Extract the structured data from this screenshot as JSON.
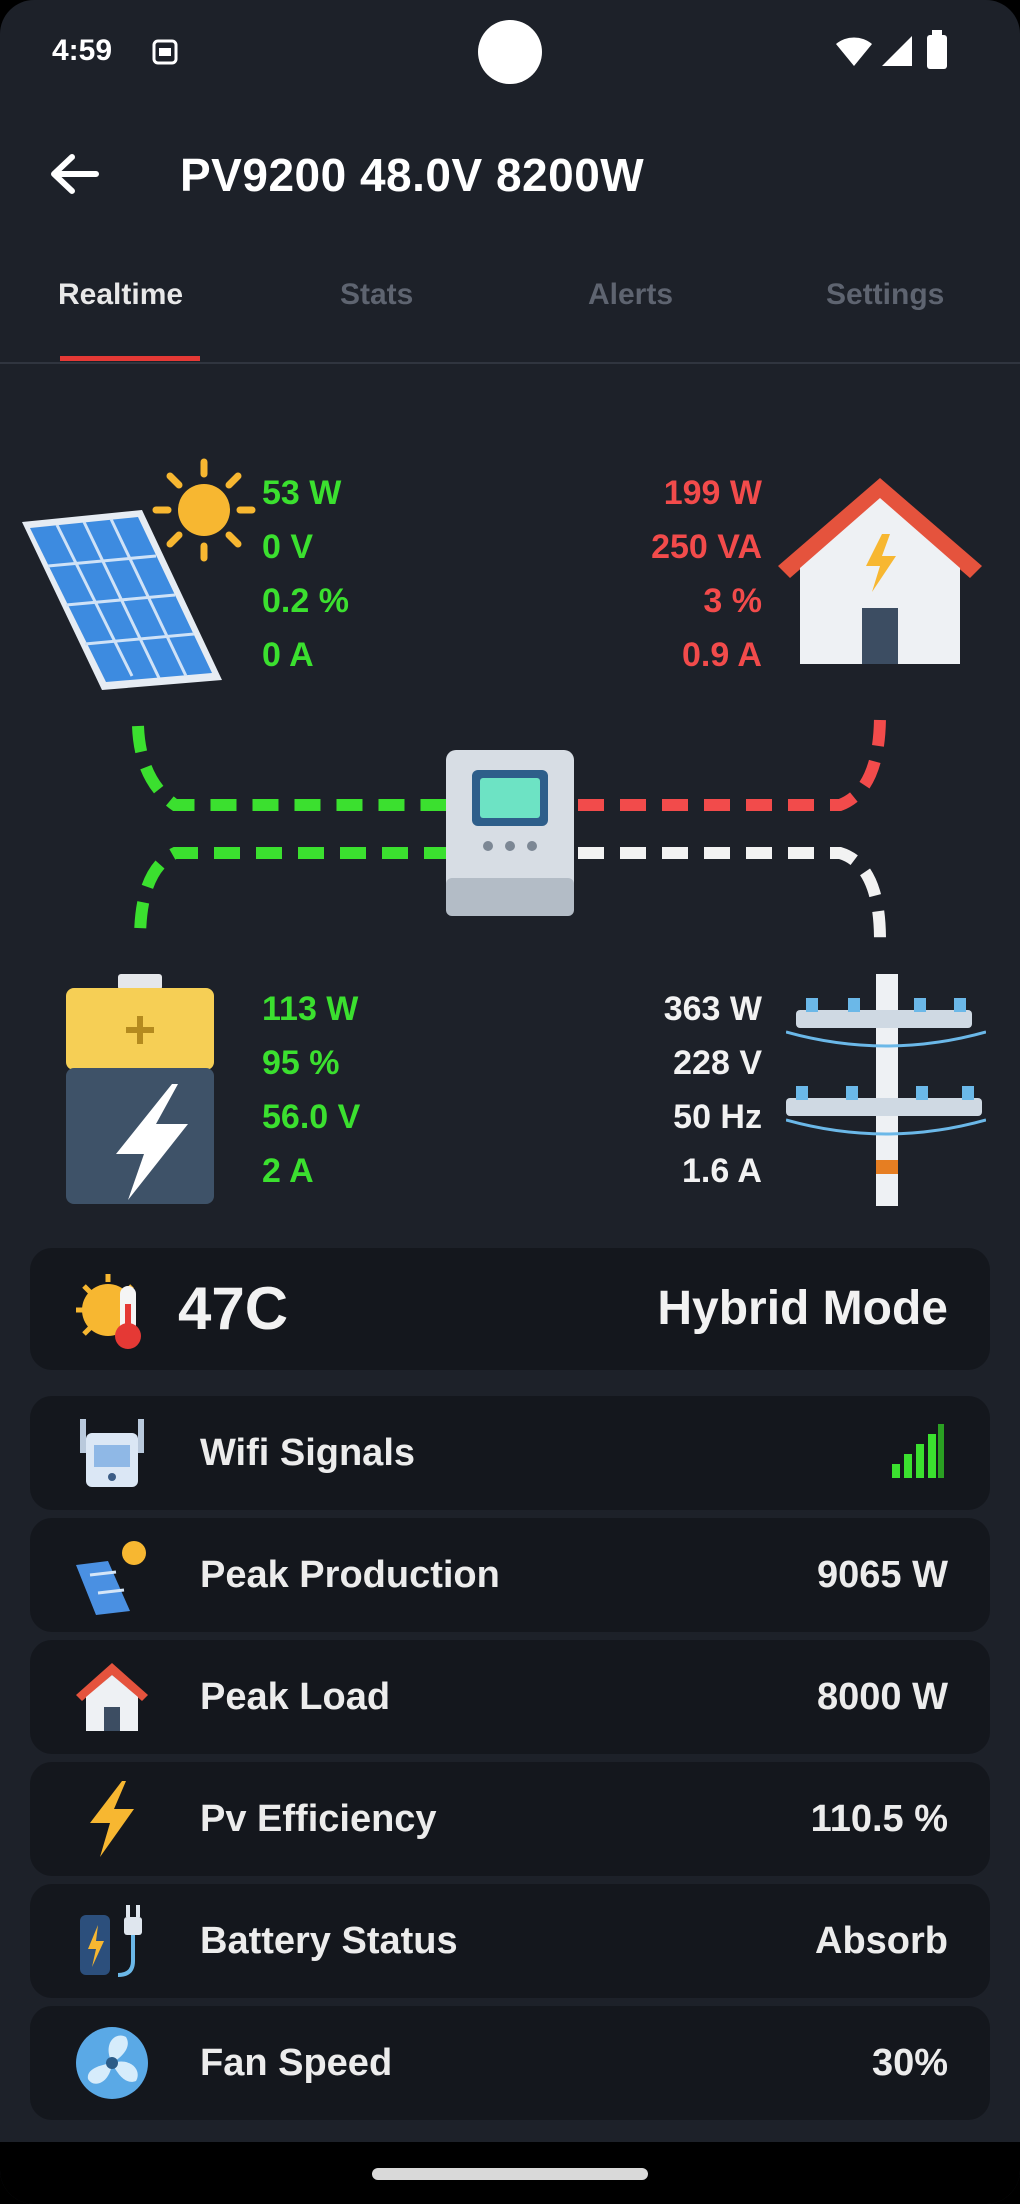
{
  "status_bar": {
    "time": "4:59",
    "icons": [
      "sim-card-icon",
      "wifi-icon",
      "signal-icon",
      "battery-icon"
    ]
  },
  "header": {
    "title": "PV9200 48.0V 8200W",
    "back_icon": "arrow-left-icon"
  },
  "tabs": [
    {
      "label": "Realtime",
      "active": true
    },
    {
      "label": "Stats",
      "active": false
    },
    {
      "label": "Alerts",
      "active": false
    },
    {
      "label": "Settings",
      "active": false
    }
  ],
  "solar": {
    "power": "53 W",
    "voltage": "0 V",
    "percent": "0.2 %",
    "current": "0 A",
    "color": "#3be02f"
  },
  "load": {
    "power": "199 W",
    "apparent": "250 VA",
    "percent": "3 %",
    "current": "0.9 A",
    "color": "#f24b4b"
  },
  "battery": {
    "power": "113 W",
    "percent": "95 %",
    "voltage": "56.0 V",
    "current": "2 A"
  },
  "grid": {
    "power": "363 W",
    "voltage": "228 V",
    "frequency": "50 Hz",
    "current": "1.6 A"
  },
  "summary": {
    "temperature": "47C",
    "mode": "Hybrid Mode"
  },
  "info_rows": [
    {
      "label": "Wifi Signals",
      "value": "",
      "icon": "wifi-router-icon"
    },
    {
      "label": "Peak Production",
      "value": "9065 W",
      "icon": "solar-panel-icon"
    },
    {
      "label": "Peak Load",
      "value": "8000 W",
      "icon": "house-icon"
    },
    {
      "label": "Pv Efficiency",
      "value": "110.5 %",
      "icon": "lightning-bolt-icon"
    },
    {
      "label": "Battery Status",
      "value": "Absorb",
      "icon": "battery-charging-icon"
    },
    {
      "label": "Fan Speed",
      "value": "30%",
      "icon": "fan-icon"
    }
  ],
  "colors": {
    "background": "#1d2129",
    "card": "#14171d",
    "accent": "#e53935",
    "solar": "#3be02f",
    "load": "#f24b4b",
    "grid": "#f2f2f2"
  }
}
